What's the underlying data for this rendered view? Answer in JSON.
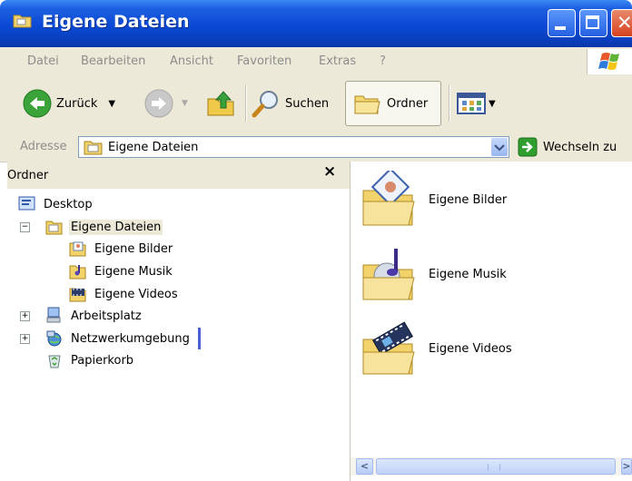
{
  "window": {
    "title": "Eigene Dateien"
  },
  "menu": [
    "Datei",
    "Bearbeiten",
    "Ansicht",
    "Favoriten",
    "Extras",
    "?"
  ],
  "toolbar": {
    "back_label": "Zurück",
    "search_label": "Suchen",
    "folders_label": "Ordner"
  },
  "address": {
    "label": "Adresse",
    "value": "Eigene Dateien",
    "go_label": "Wechseln zu"
  },
  "left_pane": {
    "title": "Ordner",
    "close_symbol": "×",
    "tree": [
      {
        "label": "Desktop",
        "icon": "desktop-icon"
      },
      {
        "label": "Eigene Dateien",
        "icon": "my-documents-icon",
        "expander": "−",
        "selected": true
      },
      {
        "label": "Eigene Bilder",
        "icon": "my-pictures-icon"
      },
      {
        "label": "Eigene Musik",
        "icon": "my-music-icon"
      },
      {
        "label": "Eigene Videos",
        "icon": "my-videos-icon"
      },
      {
        "label": "Arbeitsplatz",
        "icon": "my-computer-icon",
        "expander": "+"
      },
      {
        "label": "Netzwerkumgebung",
        "icon": "network-places-icon",
        "expander": "+"
      },
      {
        "label": "Papierkorb",
        "icon": "recycle-bin-icon"
      }
    ]
  },
  "files": [
    {
      "label": "Eigene Bilder",
      "icon": "pictures-folder-icon"
    },
    {
      "label": "Eigene Musik",
      "icon": "music-folder-icon"
    },
    {
      "label": "Eigene Videos",
      "icon": "videos-folder-icon"
    }
  ],
  "colors": {
    "titlebar": "#0a49d6",
    "chrome": "#ece9d8",
    "menu_text_disabled": "#8d8d8d",
    "go_arrow": "#2f9e2f"
  }
}
